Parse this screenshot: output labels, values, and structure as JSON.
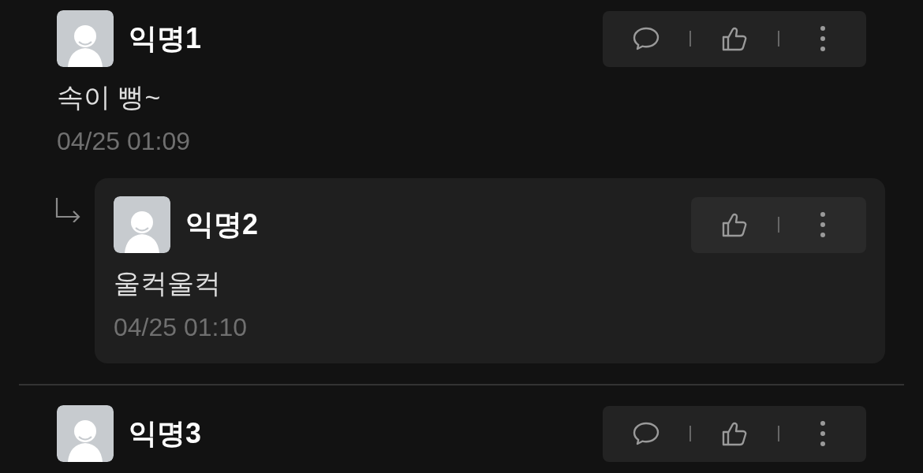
{
  "comments": [
    {
      "name": "익명1",
      "text": "속이 뻥~",
      "time": "04/25 01:09",
      "replies": [
        {
          "name": "익명2",
          "text": "울컥울컥",
          "time": "04/25 01:10"
        }
      ]
    },
    {
      "name": "익명3"
    }
  ]
}
